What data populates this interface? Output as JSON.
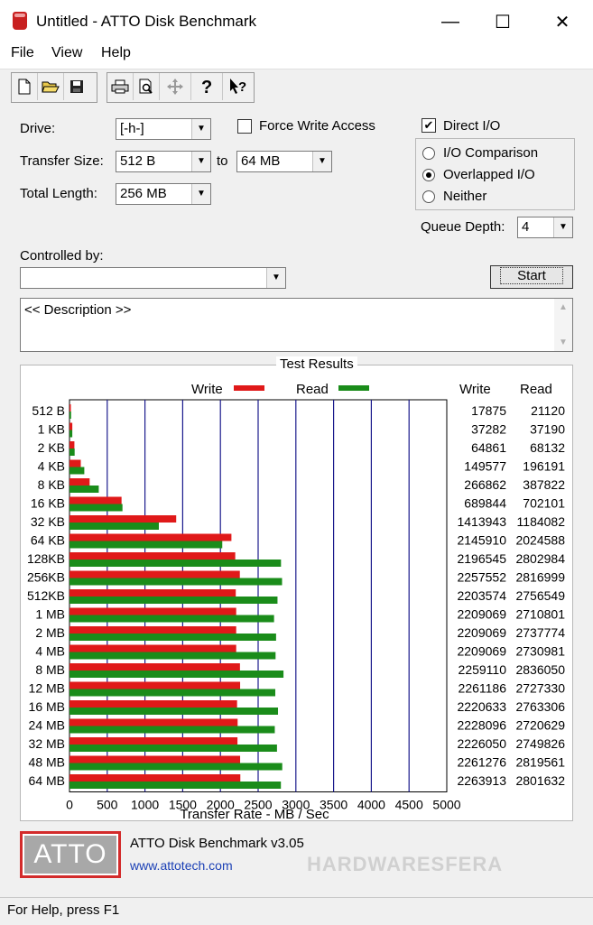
{
  "window": {
    "title": "Untitled - ATTO Disk Benchmark",
    "minimize": "—",
    "maximize": "☐",
    "close": "✕"
  },
  "menu": [
    "File",
    "View",
    "Help"
  ],
  "toolbar": {
    "icons": [
      "new-icon",
      "open-icon",
      "save-icon",
      "print-icon",
      "print-preview-icon",
      "move-icon",
      "help-icon",
      "context-help-icon"
    ]
  },
  "form": {
    "drive_label": "Drive:",
    "drive_value": "[-h-]",
    "force_write_label": "Force Write Access",
    "force_write_checked": false,
    "direct_io_label": "Direct I/O",
    "direct_io_checked": true,
    "transfer_size_label": "Transfer Size:",
    "transfer_from": "512 B",
    "to_label": "to",
    "transfer_to": "64 MB",
    "total_length_label": "Total Length:",
    "total_length_value": "256 MB",
    "io_options": [
      "I/O Comparison",
      "Overlapped I/O",
      "Neither"
    ],
    "io_selected": "Overlapped I/O",
    "queue_depth_label": "Queue Depth:",
    "queue_depth_value": "4",
    "controlled_by_label": "Controlled by:",
    "controlled_by_value": "",
    "start_label": "Start",
    "description": "<< Description >>"
  },
  "results": {
    "title": "Test Results",
    "legend_write": "Write",
    "legend_read": "Read",
    "col_write": "Write",
    "col_read": "Read"
  },
  "chart_data": {
    "type": "bar",
    "orientation": "horizontal",
    "xlabel": "Transfer Rate - MB / Sec",
    "xlim": [
      0,
      5000
    ],
    "xticks": [
      0,
      500,
      1000,
      1500,
      2000,
      2500,
      3000,
      3500,
      4000,
      4500,
      5000
    ],
    "grid": true,
    "colors": {
      "write": "#e01919",
      "read": "#1a8c1a"
    },
    "categories": [
      "512 B",
      "1 KB",
      "2 KB",
      "4 KB",
      "8 KB",
      "16 KB",
      "32 KB",
      "64 KB",
      "128KB",
      "256KB",
      "512KB",
      "1 MB",
      "2 MB",
      "4 MB",
      "8 MB",
      "12 MB",
      "16 MB",
      "24 MB",
      "32 MB",
      "48 MB",
      "64 MB"
    ],
    "series": [
      {
        "name": "Write",
        "values": [
          17875,
          37282,
          64861,
          149577,
          266862,
          689844,
          1413943,
          2145910,
          2196545,
          2257552,
          2203574,
          2209069,
          2209069,
          2209069,
          2259110,
          2261186,
          2220633,
          2228096,
          2226050,
          2261276,
          2263913
        ]
      },
      {
        "name": "Read",
        "values": [
          21120,
          37190,
          68132,
          196191,
          387822,
          702101,
          1184082,
          2024588,
          2802984,
          2816999,
          2756549,
          2710801,
          2737774,
          2730981,
          2836050,
          2727330,
          2763306,
          2720629,
          2749826,
          2819561,
          2801632
        ]
      }
    ]
  },
  "branding": {
    "logo_text": "ATTO",
    "product": "ATTO Disk Benchmark v3.05",
    "url": "www.attotech.com",
    "watermark": "HARDWARESFERA"
  },
  "status": "For Help, press F1"
}
